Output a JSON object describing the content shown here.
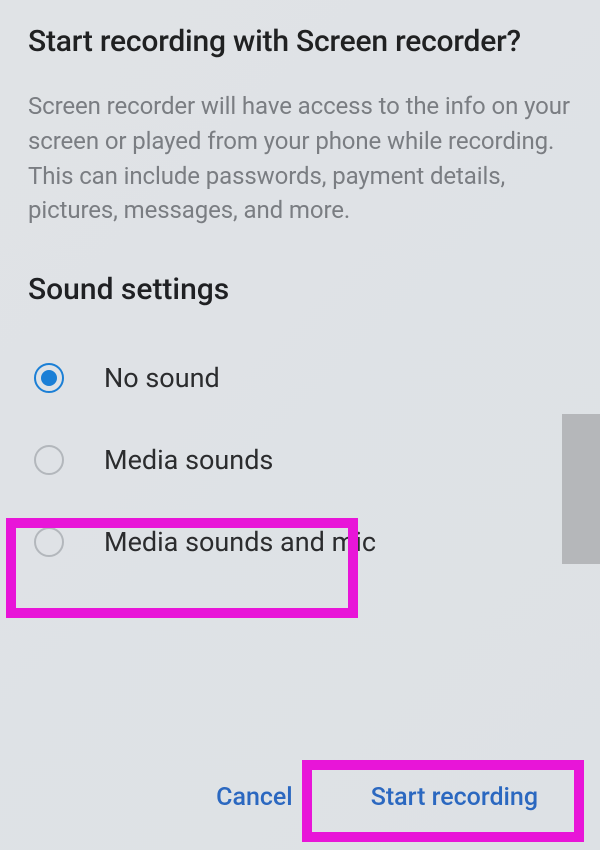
{
  "dialog": {
    "title": "Start recording with Screen recorder?",
    "description": "Screen recorder will have access to the info on your screen or played from your phone while recording. This can include passwords, payment details, pictures, messages, and more.",
    "sound_heading": "Sound settings",
    "options": [
      {
        "label": "No sound",
        "selected": true
      },
      {
        "label": "Media sounds",
        "selected": false
      },
      {
        "label": "Media sounds and mic",
        "selected": false
      }
    ],
    "cancel_label": "Cancel",
    "confirm_label": "Start recording"
  }
}
